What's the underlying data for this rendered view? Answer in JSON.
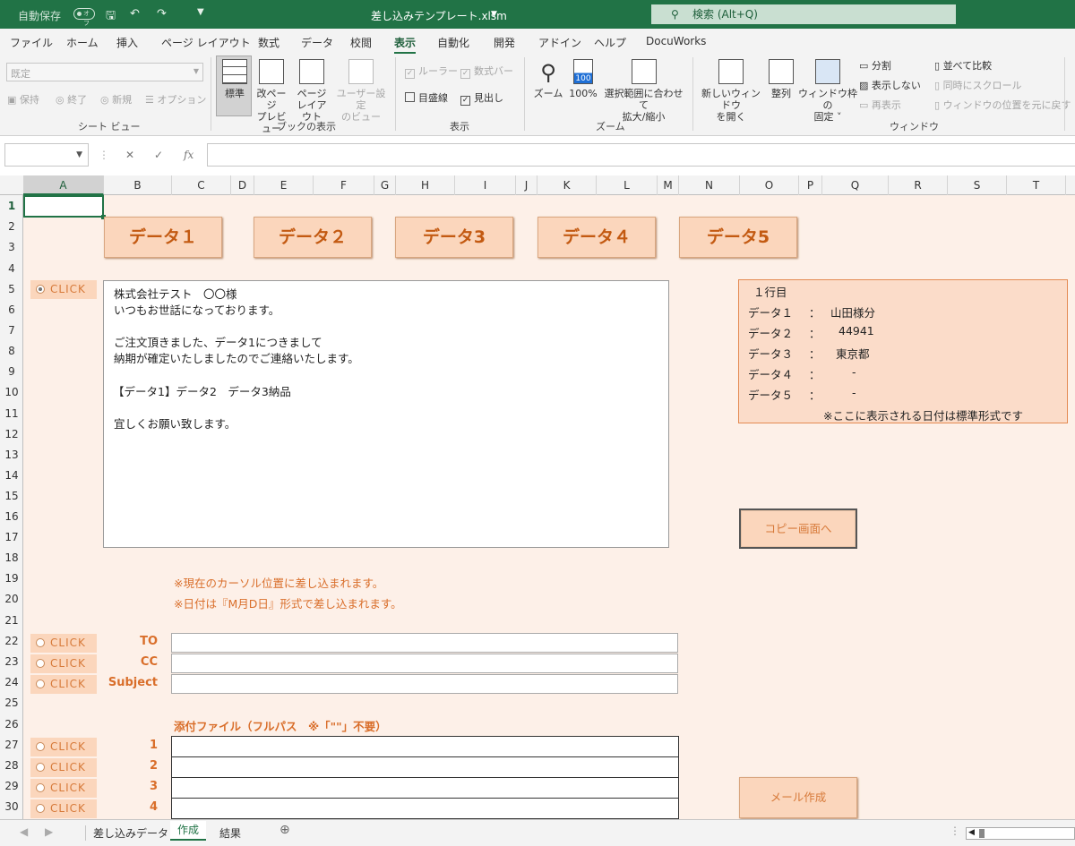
{
  "titlebar": {
    "autosave": "自動保存",
    "autosave_state": "オフ",
    "filename": "差し込みテンプレート.xlsm",
    "search": "検索 (Alt+Q)"
  },
  "menu": [
    "ファイル",
    "ホーム",
    "挿入",
    "ページ レイアウト",
    "数式",
    "データ",
    "校閲",
    "表示",
    "自動化",
    "開発",
    "アドイン",
    "ヘルプ",
    "DocuWorks"
  ],
  "ribbon": {
    "sheet_view": {
      "select": "既定",
      "keep": "保持",
      "exit": "終了",
      "new": "新規",
      "options": "オプション",
      "group": "シート ビュー"
    },
    "workbook_view": {
      "normal": "標準",
      "page_break_1": "改ページ",
      "page_break_2": "プレビュー",
      "page_layout_1": "ページ",
      "page_layout_2": "レイアウト",
      "custom_1": "ユーザー設定",
      "custom_2": "のビュー",
      "group": "ブックの表示"
    },
    "show": {
      "ruler": "ルーラー",
      "formula_bar": "数式バー",
      "gridlines": "目盛線",
      "headings": "見出し",
      "group": "表示"
    },
    "zoom": {
      "zoom": "ズーム",
      "hundred": "100%",
      "selection_1": "選択範囲に合わせて",
      "selection_2": "拡大/縮小",
      "group": "ズーム",
      "icon_100": "100"
    },
    "window": {
      "new_window_1": "新しいウィンドウ",
      "new_window_2": "を開く",
      "arrange": "整列",
      "freeze_1": "ウィンドウ枠の",
      "freeze_2": "固定",
      "split": "分割",
      "hide": "表示しない",
      "unhide": "再表示",
      "side_by_side": "並べて比較",
      "sync_scroll": "同時にスクロール",
      "reset_pos": "ウィンドウの位置を元に戻す",
      "group": "ウィンドウ"
    }
  },
  "formula": {
    "fx": "fx"
  },
  "columns": [
    "A",
    "B",
    "C",
    "D",
    "E",
    "F",
    "G",
    "H",
    "I",
    "J",
    "K",
    "L",
    "M",
    "N",
    "O",
    "P",
    "Q",
    "R",
    "S",
    "T"
  ],
  "rows": [
    "1",
    "2",
    "3",
    "4",
    "5",
    "6",
    "7",
    "8",
    "9",
    "10",
    "11",
    "12",
    "13",
    "14",
    "15",
    "16",
    "17",
    "18",
    "19",
    "20",
    "21",
    "22",
    "23",
    "24",
    "25",
    "26",
    "27",
    "28",
    "29",
    "30"
  ],
  "data_buttons": [
    "データ１",
    "データ２",
    "データ3",
    "データ４",
    "データ5"
  ],
  "click_label": "CLICK",
  "body_lines": [
    "株式会社テスト　〇〇様",
    "いつもお世話になっております。",
    "ご注文頂きました、データ1につきまして",
    "納期が確定いたしましたのでご連絡いたします。",
    "【データ1】データ2　データ3納品",
    "宜しくお願い致します。"
  ],
  "info": {
    "title": "１行目",
    "rows": [
      {
        "label": "データ１",
        "value": "山田様分"
      },
      {
        "label": "データ２",
        "value": "44941"
      },
      {
        "label": "データ３",
        "value": "東京都"
      },
      {
        "label": "データ４",
        "value": "-"
      },
      {
        "label": "データ５",
        "value": "-"
      }
    ],
    "sep": "：",
    "note": "※ここに表示される日付は標準形式です"
  },
  "copy_button": "コピー画面へ",
  "notes": [
    "※現在のカーソル位置に差し込まれます。",
    "※日付は『M月D日』形式で差し込まれます。"
  ],
  "mail_fields": [
    "TO",
    "CC",
    "Subject"
  ],
  "attach_title": "添付ファイル（フルパス　※「\"\"」不要）",
  "attach_rows": [
    "1",
    "2",
    "3",
    "4"
  ],
  "mail_button": "メール作成",
  "tabs": [
    "差し込みデータ",
    "作成",
    "結果"
  ]
}
